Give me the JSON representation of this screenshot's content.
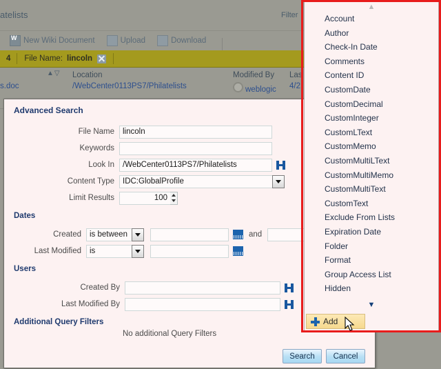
{
  "background": {
    "page_title": "atelists",
    "filter_label": "Filter",
    "toolbar": [
      {
        "label": "New Wiki Document",
        "icon": "wiki-document-icon"
      },
      {
        "label": "Upload",
        "icon": "upload-icon"
      },
      {
        "label": "Download",
        "icon": "download-icon"
      }
    ],
    "filter_bar": {
      "count": "4",
      "label": "File Name:",
      "value": "lincoln",
      "clear_icon": "remove-filter-icon"
    },
    "columns": {
      "sort": "sort-icons",
      "location": "Location",
      "modified_by": "Modified By",
      "last": "Las"
    },
    "rows": [
      {
        "name": "s.doc",
        "location": "/WebCenter0113PS7/Philatelists",
        "modified_by": "weblogic",
        "last": "4/2"
      }
    ]
  },
  "dialog": {
    "title": "Advanced Search",
    "fields": {
      "file_name_label": "File Name",
      "file_name_value": "lincoln",
      "keywords_label": "Keywords",
      "keywords_value": "",
      "look_in_label": "Look In",
      "look_in_value": "/WebCenter0113PS7/Philatelists",
      "content_type_label": "Content Type",
      "content_type_value": "IDC:GlobalProfile",
      "limit_results_label": "Limit Results",
      "limit_results_value": "100"
    },
    "dates": {
      "section_label": "Dates",
      "created_label": "Created",
      "created_operator": "is between",
      "created_from": "",
      "and_label": "and",
      "created_to": "",
      "last_modified_label": "Last Modified",
      "last_modified_operator": "is",
      "last_modified_value": ""
    },
    "users": {
      "section_label": "Users",
      "created_by_label": "Created By",
      "created_by_value": "",
      "last_modified_by_label": "Last Modified By",
      "last_modified_by_value": ""
    },
    "additional": {
      "section_label": "Additional Query Filters",
      "empty_text": "No additional Query Filters"
    },
    "buttons": {
      "search": "Search",
      "cancel": "Cancel"
    }
  },
  "dropdown": {
    "scroll_up_icon": "chevron-up-icon",
    "scroll_down_icon": "chevron-down-icon",
    "items": [
      "Account",
      "Author",
      "Check-In Date",
      "Comments",
      "Content ID",
      "CustomDate",
      "CustomDecimal",
      "CustomInteger",
      "CustomLText",
      "CustomMemo",
      "CustomMultiLText",
      "CustomMultiMemo",
      "CustomMultiText",
      "CustomText",
      "Exclude From Lists",
      "Expiration Date",
      "Folder",
      "Format",
      "Group Access List",
      "Hidden"
    ],
    "add_button": "Add"
  },
  "annotation": {
    "highlight_color": "#e81c1c"
  }
}
